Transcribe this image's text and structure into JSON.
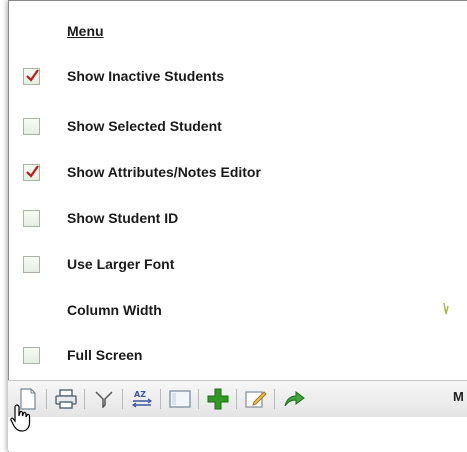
{
  "menu": {
    "title": "Menu",
    "items": [
      {
        "label": "Show Inactive Students",
        "checked": true
      },
      {
        "label": "Show Selected Student",
        "checked": false
      },
      {
        "label": "Show Attributes/Notes Editor",
        "checked": true
      },
      {
        "label": "Show Student ID",
        "checked": false
      },
      {
        "label": "Use Larger Font",
        "checked": false
      },
      {
        "label": "Column Width",
        "type": "slider"
      },
      {
        "label": "Full Screen",
        "checked": false
      }
    ]
  },
  "toolbar": {
    "buttons": [
      "new-document-icon",
      "print-icon",
      "filter-icon",
      "sort-az-icon",
      "window-icon",
      "add-icon",
      "edit-icon",
      "forward-arrow-icon"
    ],
    "overflow_text": "M"
  },
  "colors": {
    "check": "#c01a1a",
    "checkbox_border": "#a7b5a2",
    "add_green": "#2f9a22"
  }
}
